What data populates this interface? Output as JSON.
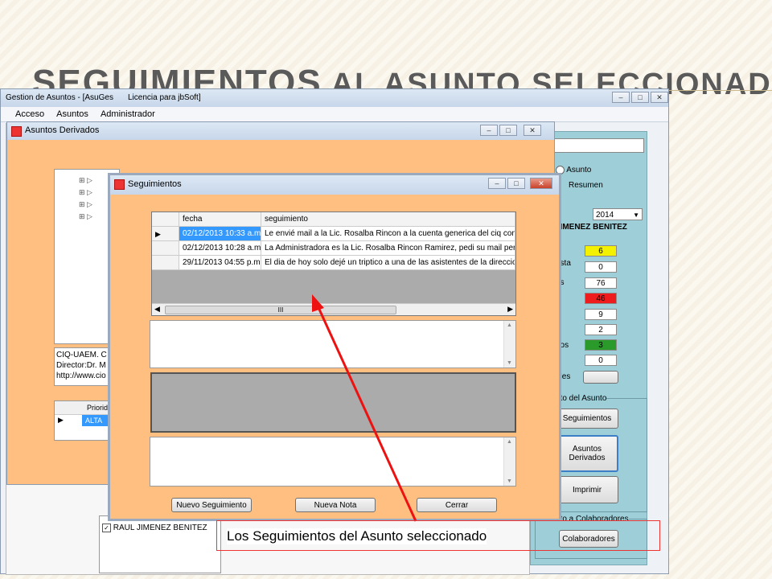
{
  "slide": {
    "title_main": "SEGUIMIENTOS",
    "title_rest": "AL ASUNTO SELECCIONADO",
    "caption": "Los Seguimientos del Asunto seleccionado"
  },
  "main_window": {
    "title": "Gestion de Asuntos - [AsuGes",
    "license": "Licencia para jbSoft]",
    "menu": [
      "Acceso",
      "Asuntos",
      "Administrador"
    ],
    "right_panel": {
      "radio_asunto": "Asunto",
      "radio_resumen": "Resumen",
      "year": "2014",
      "person": "JIMENEZ BENITEZ",
      "stat_labels": [
        "esta",
        "es",
        "s",
        "s",
        "n",
        "dos",
        "ales"
      ],
      "stat_values": [
        "6",
        "0",
        "76",
        "46",
        "9",
        "2",
        "3",
        "0"
      ],
      "stat_colors": [
        "#f3f000",
        "#ffffff",
        "#ffffff",
        "#ee1c1c",
        "#ffffff",
        "#ffffff",
        "#2a9a2a",
        "#ffffff"
      ],
      "group1": "nto del Asunto",
      "btn_seguimientos": "Seguimientos",
      "btn_derivados": "Asuntos Derivados",
      "btn_imprimir": "Imprimir",
      "group2": "nto a Colaboradores",
      "btn_colaboradores": "Colaboradores"
    },
    "bottom_list_item": "RAUL JIMENEZ BENITEZ"
  },
  "derivados_window": {
    "title": "Asuntos Derivados",
    "info_lines": [
      "CIQ-UAEM. C",
      "Director:Dr. M",
      "http://www.cio"
    ],
    "prior_header": "Priorid",
    "prior_value": "ALTA"
  },
  "seguimientos_window": {
    "title": "Seguimientos",
    "columns": [
      "fecha",
      "seguimiento"
    ],
    "rows": [
      {
        "fecha": "02/12/2013 10:33 a.m.",
        "seguimiento": "Le envié mail a la Lic. Rosalba Rincon a la cuenta generica del ciq con inform"
      },
      {
        "fecha": "02/12/2013 10:28 a.m.",
        "seguimiento": "La Administradora es la Lic. Rosalba Rincon Ramirez, pedi su mail pero me dij"
      },
      {
        "fecha": "29/11/2013 04:55 p.m.",
        "seguimiento": "El dia de hoy solo dejé un triptico a una de las asistentes de la direccion y obtu"
      }
    ],
    "scroll_grip": "III",
    "buttons": {
      "nuevo": "Nuevo Seguimiento",
      "nota": "Nueva Nota",
      "cerrar": "Cerrar"
    }
  }
}
